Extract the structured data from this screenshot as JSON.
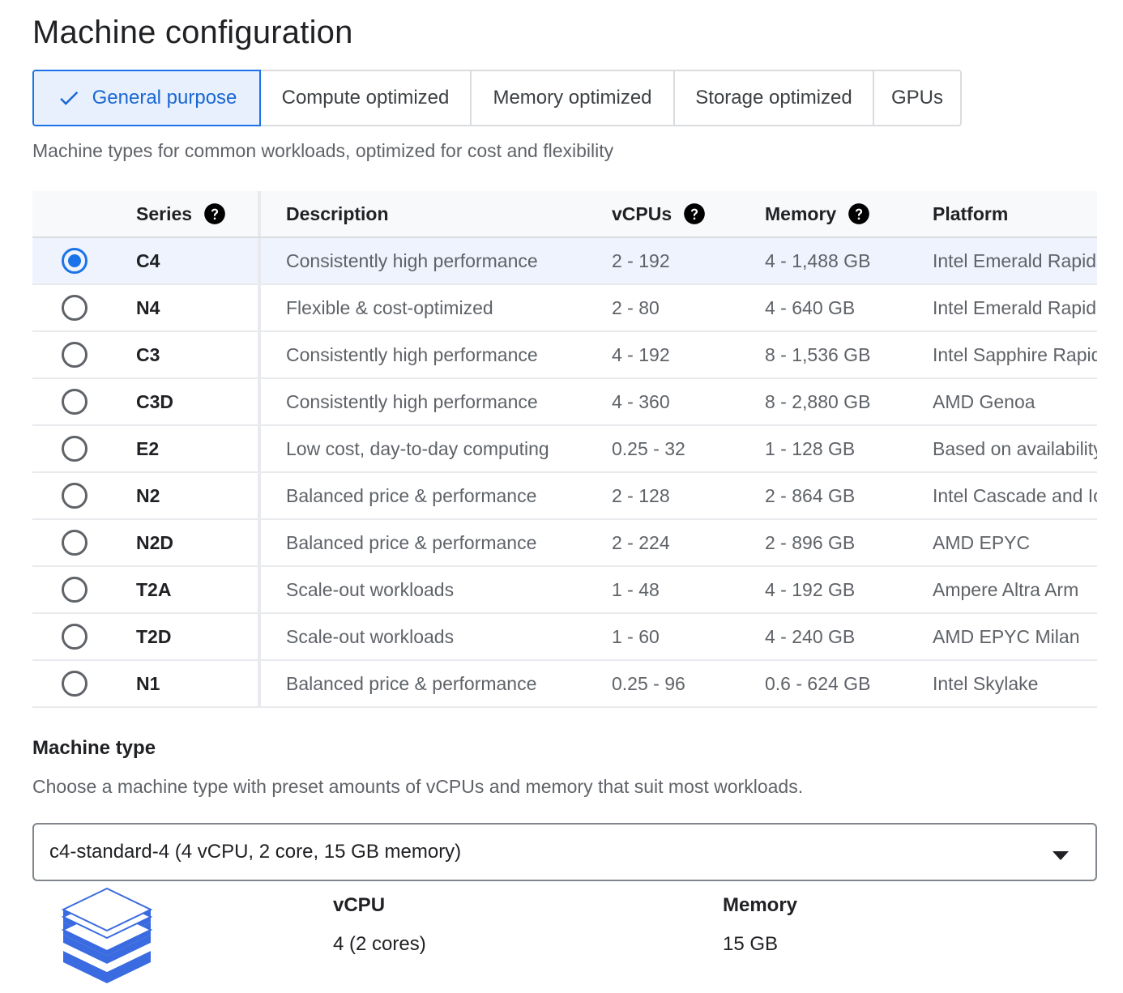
{
  "page_title": "Machine configuration",
  "tabs": [
    {
      "label": "General purpose",
      "selected": true
    },
    {
      "label": "Compute optimized",
      "selected": false
    },
    {
      "label": "Memory optimized",
      "selected": false
    },
    {
      "label": "Storage optimized",
      "selected": false
    },
    {
      "label": "GPUs",
      "selected": false
    }
  ],
  "tab_description": "Machine types for common workloads, optimized for cost and flexibility",
  "table": {
    "headers": {
      "series": "Series",
      "description": "Description",
      "vcpus": "vCPUs",
      "memory": "Memory",
      "platform": "Platform"
    },
    "rows": [
      {
        "series": "C4",
        "description": "Consistently high performance",
        "vcpus": "2 - 192",
        "memory": "4 - 1,488 GB",
        "platform": "Intel Emerald Rapids",
        "selected": true
      },
      {
        "series": "N4",
        "description": "Flexible & cost-optimized",
        "vcpus": "2 - 80",
        "memory": "4 - 640 GB",
        "platform": "Intel Emerald Rapids",
        "selected": false
      },
      {
        "series": "C3",
        "description": "Consistently high performance",
        "vcpus": "4 - 192",
        "memory": "8 - 1,536 GB",
        "platform": "Intel Sapphire Rapids",
        "selected": false
      },
      {
        "series": "C3D",
        "description": "Consistently high performance",
        "vcpus": "4 - 360",
        "memory": "8 - 2,880 GB",
        "platform": "AMD Genoa",
        "selected": false
      },
      {
        "series": "E2",
        "description": "Low cost, day-to-day computing",
        "vcpus": "0.25 - 32",
        "memory": "1 - 128 GB",
        "platform": "Based on availability",
        "selected": false
      },
      {
        "series": "N2",
        "description": "Balanced price & performance",
        "vcpus": "2 - 128",
        "memory": "2 - 864 GB",
        "platform": "Intel Cascade and Ice Lake",
        "selected": false
      },
      {
        "series": "N2D",
        "description": "Balanced price & performance",
        "vcpus": "2 - 224",
        "memory": "2 - 896 GB",
        "platform": "AMD EPYC",
        "selected": false
      },
      {
        "series": "T2A",
        "description": "Scale-out workloads",
        "vcpus": "1 - 48",
        "memory": "4 - 192 GB",
        "platform": "Ampere Altra Arm",
        "selected": false
      },
      {
        "series": "T2D",
        "description": "Scale-out workloads",
        "vcpus": "1 - 60",
        "memory": "4 - 240 GB",
        "platform": "AMD EPYC Milan",
        "selected": false
      },
      {
        "series": "N1",
        "description": "Balanced price & performance",
        "vcpus": "0.25 - 96",
        "memory": "0.6 - 624 GB",
        "platform": "Intel Skylake",
        "selected": false
      }
    ]
  },
  "machine_type": {
    "title": "Machine type",
    "description": "Choose a machine type with preset amounts of vCPUs and memory that suit most workloads.",
    "selected_value": "c4-standard-4 (4 vCPU, 2 core, 15 GB memory)",
    "specs": {
      "vcpu_label": "vCPU",
      "vcpu_value": "4 (2 cores)",
      "memory_label": "Memory",
      "memory_value": "15 GB"
    }
  },
  "icons": {
    "tab_check": "check-icon",
    "header_help": "help-circle-icon",
    "select_arrow": "arrow-drop-down-icon",
    "machine_illustration": "layers-stack-icon"
  },
  "colors": {
    "accent": "#1a73e8",
    "selected_tab_bg": "#e8f0fe",
    "selected_row_bg": "#eef3fd",
    "text_primary": "#202124",
    "text_secondary": "#5f6368"
  }
}
